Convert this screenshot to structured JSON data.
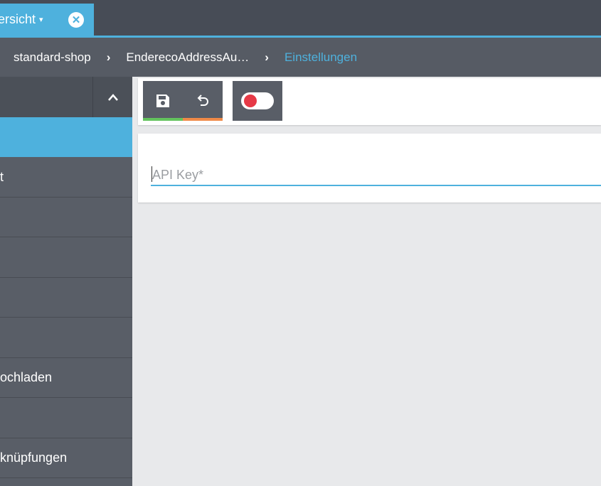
{
  "tabbar": {
    "tab_label": "ersicht",
    "tab_caret": "▾",
    "close_glyph": "✕",
    "accent_color": "#4eb1dd"
  },
  "breadcrumb": {
    "items": [
      "standard-shop",
      "EnderecoAddressAu…",
      "Einstellungen"
    ],
    "separator": "›"
  },
  "sidebar": {
    "collapse_glyph": "⌃",
    "items": [
      {
        "label": ""
      },
      {
        "label": "t"
      },
      {
        "label": ""
      },
      {
        "label": ""
      },
      {
        "label": ""
      },
      {
        "label": ""
      },
      {
        "label": "ochladen"
      },
      {
        "label": ""
      },
      {
        "label": "knüpfungen"
      }
    ]
  },
  "toolbar": {
    "save_icon": "floppy-disk-icon",
    "undo_icon": "undo-icon",
    "toggle_state": "off",
    "toggle_color": "#e63946"
  },
  "form": {
    "api_key_placeholder": "API Key*",
    "api_key_value": ""
  }
}
